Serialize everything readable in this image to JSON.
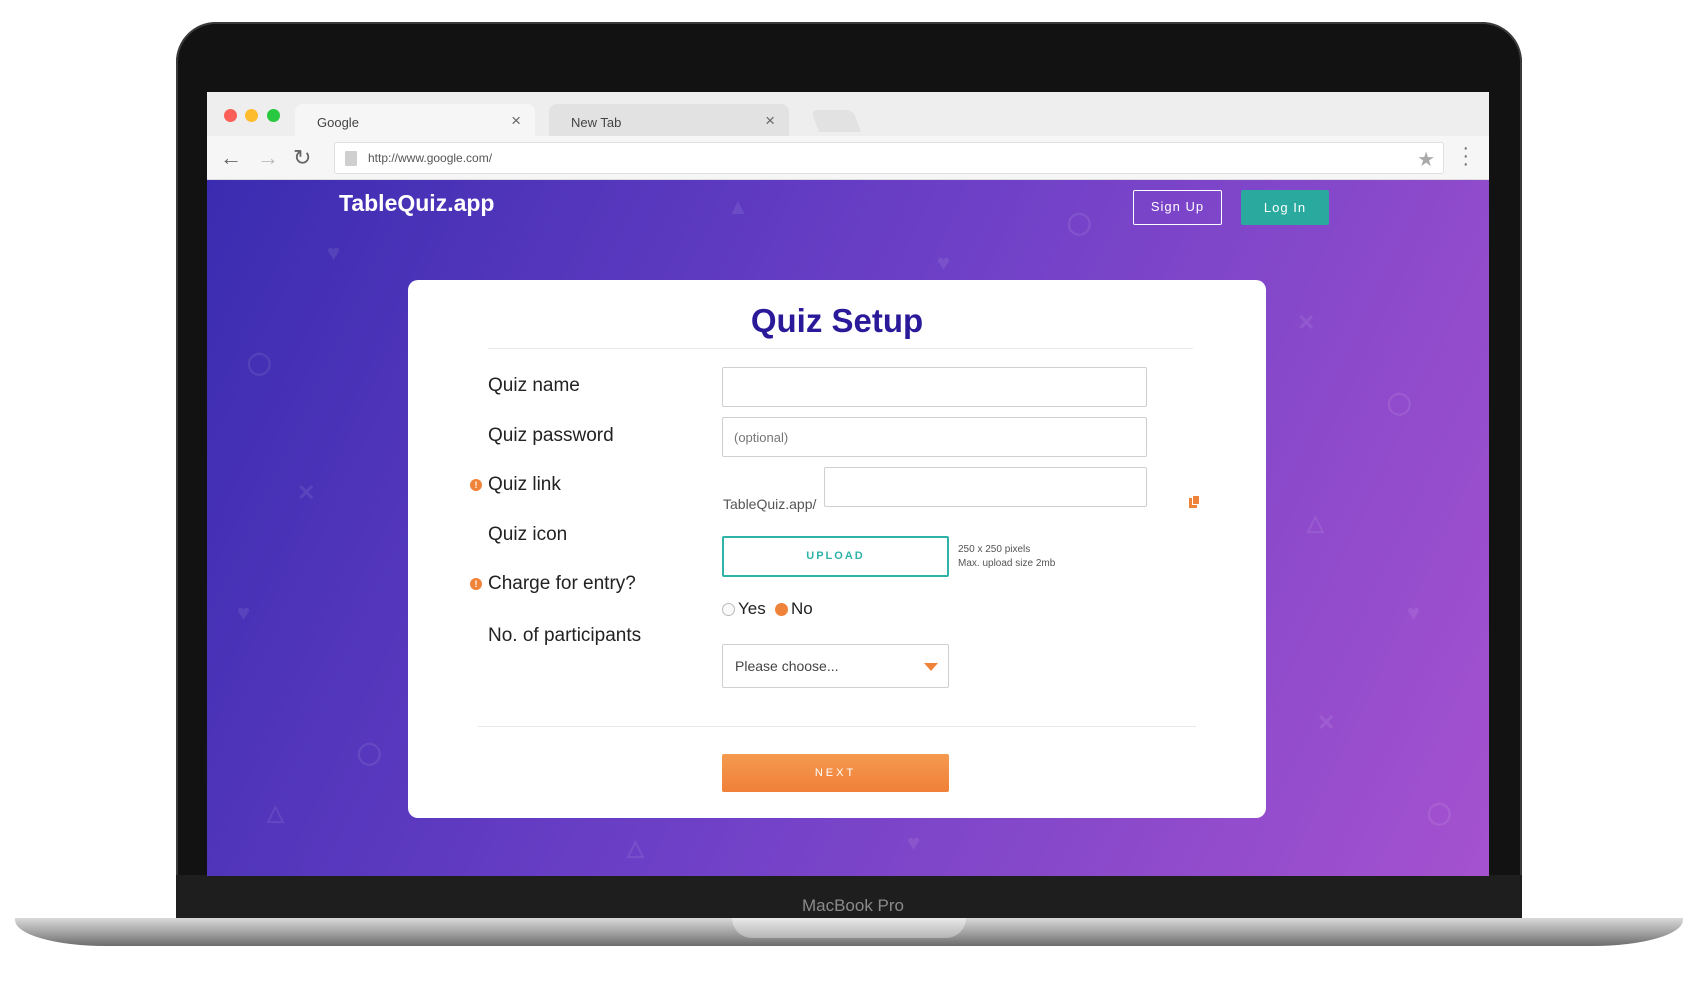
{
  "device": {
    "brand_label": "MacBook Pro"
  },
  "browser": {
    "tabs": [
      {
        "label": "Google",
        "active": true
      },
      {
        "label": "New Tab",
        "active": false
      }
    ],
    "address_url": "http://www.google.com/"
  },
  "site": {
    "logo": "TableQuiz.app",
    "signup_label": "Sign Up",
    "login_label": "Log In"
  },
  "form": {
    "title": "Quiz Setup",
    "quiz_name_label": "Quiz name",
    "quiz_name_value": "",
    "quiz_password_label": "Quiz password",
    "quiz_password_placeholder": "(optional)",
    "quiz_link_label": "Quiz link",
    "quiz_link_prefix": "TableQuiz.app/",
    "quiz_link_value": "",
    "quiz_icon_label": "Quiz icon",
    "upload_label": "UPLOAD",
    "upload_hint_size": "250 x 250 pixels",
    "upload_hint_max": "Max. upload size 2mb",
    "charge_label": "Charge for entry?",
    "charge_options": [
      {
        "label": "Yes",
        "selected": false
      },
      {
        "label": "No",
        "selected": true
      }
    ],
    "participants_label": "No. of participants",
    "participants_selected": "Please choose...",
    "next_label": "NEXT"
  },
  "colors": {
    "brand_purple": "#2a1a9a",
    "accent_orange": "#f0833a",
    "accent_teal": "#2fb3a6"
  }
}
